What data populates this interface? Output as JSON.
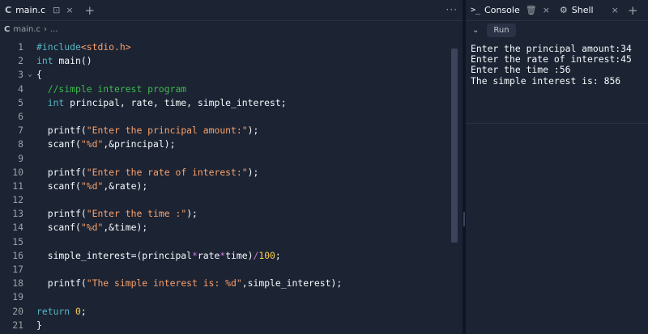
{
  "editor": {
    "tab": {
      "icon": "c-file-icon",
      "label": "main.c"
    },
    "breadcrumb": {
      "file": "main.c",
      "separator": "›",
      "rest": "..."
    },
    "more_label": "···",
    "code_lines": [
      {
        "n": "1",
        "fold": "",
        "parts": [
          {
            "c": "pp",
            "t": "#include"
          },
          {
            "c": "hd",
            "t": "<stdio.h>"
          }
        ]
      },
      {
        "n": "2",
        "fold": "",
        "parts": [
          {
            "c": "kw",
            "t": "int"
          },
          {
            "c": "",
            "t": " main()"
          }
        ]
      },
      {
        "n": "3",
        "fold": "⌄",
        "parts": [
          {
            "c": "",
            "t": "{"
          }
        ]
      },
      {
        "n": "4",
        "fold": "",
        "parts": [
          {
            "c": "cm",
            "t": "  //simple interest program"
          }
        ]
      },
      {
        "n": "5",
        "fold": "",
        "parts": [
          {
            "c": "",
            "t": "  "
          },
          {
            "c": "kw",
            "t": "int"
          },
          {
            "c": "",
            "t": " principal, rate, time, simple_interest;"
          }
        ]
      },
      {
        "n": "6",
        "fold": "",
        "parts": []
      },
      {
        "n": "7",
        "fold": "",
        "parts": [
          {
            "c": "",
            "t": "  printf("
          },
          {
            "c": "str",
            "t": "\"Enter the principal amount:\""
          },
          {
            "c": "",
            "t": ");"
          }
        ]
      },
      {
        "n": "8",
        "fold": "",
        "parts": [
          {
            "c": "",
            "t": "  scanf("
          },
          {
            "c": "str",
            "t": "\"%d\""
          },
          {
            "c": "",
            "t": ",&principal);"
          }
        ]
      },
      {
        "n": "9",
        "fold": "",
        "parts": []
      },
      {
        "n": "10",
        "fold": "",
        "parts": [
          {
            "c": "",
            "t": "  printf("
          },
          {
            "c": "str",
            "t": "\"Enter the rate of interest:\""
          },
          {
            "c": "",
            "t": ");"
          }
        ]
      },
      {
        "n": "11",
        "fold": "",
        "parts": [
          {
            "c": "",
            "t": "  scanf("
          },
          {
            "c": "str",
            "t": "\"%d\""
          },
          {
            "c": "",
            "t": ",&rate);"
          }
        ]
      },
      {
        "n": "12",
        "fold": "",
        "parts": []
      },
      {
        "n": "13",
        "fold": "",
        "parts": [
          {
            "c": "",
            "t": "  printf("
          },
          {
            "c": "str",
            "t": "\"Enter the time :\""
          },
          {
            "c": "",
            "t": ");"
          }
        ]
      },
      {
        "n": "14",
        "fold": "",
        "parts": [
          {
            "c": "",
            "t": "  scanf("
          },
          {
            "c": "str",
            "t": "\"%d\""
          },
          {
            "c": "",
            "t": ",&time);"
          }
        ]
      },
      {
        "n": "15",
        "fold": "",
        "parts": []
      },
      {
        "n": "16",
        "fold": "",
        "parts": [
          {
            "c": "",
            "t": "  simple_interest=(principal"
          },
          {
            "c": "op",
            "t": "*"
          },
          {
            "c": "",
            "t": "rate"
          },
          {
            "c": "op",
            "t": "*"
          },
          {
            "c": "",
            "t": "time)"
          },
          {
            "c": "op",
            "t": "/"
          },
          {
            "c": "num",
            "t": "100"
          },
          {
            "c": "",
            "t": ";"
          }
        ]
      },
      {
        "n": "17",
        "fold": "",
        "parts": []
      },
      {
        "n": "18",
        "fold": "",
        "parts": [
          {
            "c": "",
            "t": "  printf("
          },
          {
            "c": "str",
            "t": "\"The simple interest is: %d\""
          },
          {
            "c": "",
            "t": ",simple_interest);"
          }
        ]
      },
      {
        "n": "19",
        "fold": "",
        "parts": []
      },
      {
        "n": "20",
        "fold": "",
        "parts": [
          {
            "c": "kw",
            "t": "return"
          },
          {
            "c": "",
            "t": " "
          },
          {
            "c": "num",
            "t": "0"
          },
          {
            "c": "",
            "t": ";"
          }
        ]
      },
      {
        "n": "21",
        "fold": "",
        "parts": [
          {
            "c": "",
            "t": "}"
          }
        ]
      }
    ]
  },
  "console": {
    "tabs": [
      {
        "icon": "terminal-prompt-icon",
        "icon_glyph": ">_",
        "label": "Console"
      },
      {
        "icon": "shell-icon",
        "icon_glyph": "⚙",
        "label": "Shell"
      }
    ],
    "run_label": "Run",
    "output": [
      "Enter the principal amount:34",
      "Enter the rate of interest:45",
      "Enter the time :56",
      "The simple interest is: 856"
    ]
  },
  "colors": {
    "background": "#1c2333",
    "keyword": "#56b6c2",
    "string": "#f9a16a",
    "comment": "#3dba4e",
    "number": "#f9ce50",
    "operator": "#c678dd"
  }
}
